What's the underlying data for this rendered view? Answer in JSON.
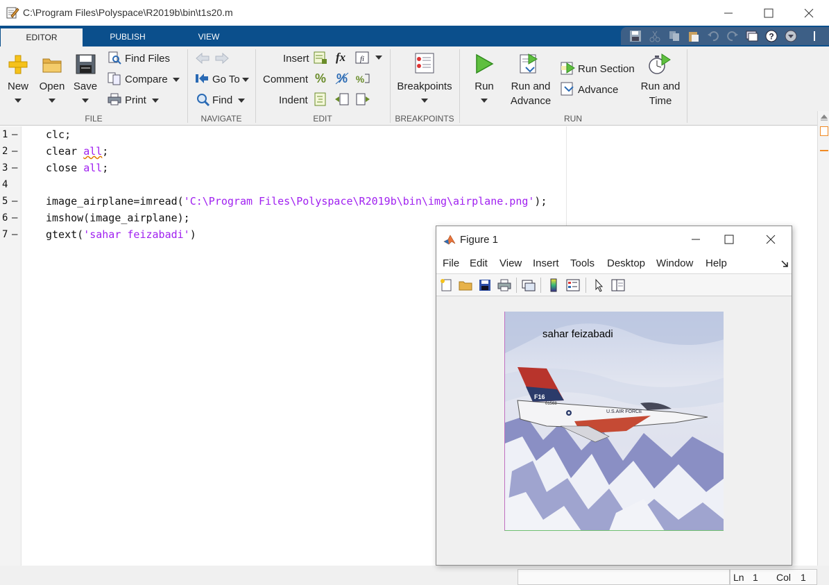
{
  "window": {
    "title": "C:\\Program Files\\Polyspace\\R2019b\\bin\\t1s20.m"
  },
  "tabs": [
    "EDITOR",
    "PUBLISH",
    "VIEW"
  ],
  "ribbon": {
    "file": {
      "group": "FILE",
      "new": "New",
      "open": "Open",
      "save": "Save",
      "find_files": "Find Files",
      "compare": "Compare",
      "print": "Print"
    },
    "navigate": {
      "group": "NAVIGATE",
      "goto": "Go To",
      "find": "Find"
    },
    "edit": {
      "group": "EDIT",
      "insert": "Insert",
      "comment": "Comment",
      "indent": "Indent",
      "fx": "fx"
    },
    "breakpoints": {
      "group": "BREAKPOINTS",
      "label": "Breakpoints"
    },
    "run": {
      "group": "RUN",
      "run": "Run",
      "run_advance_1": "Run and",
      "run_advance_2": "Advance",
      "run_section": "Run Section",
      "advance": "Advance",
      "run_time_1": "Run and",
      "run_time_2": "Time"
    }
  },
  "editor": {
    "lines": [
      {
        "num": "1",
        "dash": "–",
        "parts": [
          [
            "clc;",
            ""
          ]
        ]
      },
      {
        "num": "2",
        "dash": "–",
        "parts": [
          [
            "clear ",
            ""
          ],
          [
            "all",
            "kw-arg squiggle"
          ],
          [
            ";",
            ""
          ]
        ]
      },
      {
        "num": "3",
        "dash": "–",
        "parts": [
          [
            "close ",
            ""
          ],
          [
            "all",
            "kw-arg"
          ],
          [
            ";",
            ""
          ]
        ]
      },
      {
        "num": "4",
        "dash": "",
        "parts": []
      },
      {
        "num": "5",
        "dash": "–",
        "parts": [
          [
            "image_airplane=imread(",
            ""
          ],
          [
            "'C:\\Program Files\\Polyspace\\R2019b\\bin\\img\\airplane.png'",
            "kw-arg"
          ],
          [
            ");",
            ""
          ]
        ]
      },
      {
        "num": "6",
        "dash": "–",
        "parts": [
          [
            "imshow(image_airplane);",
            ""
          ]
        ]
      },
      {
        "num": "7",
        "dash": "–",
        "parts": [
          [
            "gtext(",
            ""
          ],
          [
            "'sahar feizabadi'",
            "kw-arg"
          ],
          [
            ")",
            ""
          ]
        ]
      }
    ]
  },
  "status": {
    "ln_label": "Ln",
    "ln_value": "1",
    "col_label": "Col",
    "col_value": "1"
  },
  "figure": {
    "title": "Figure 1",
    "menu": [
      "File",
      "Edit",
      "View",
      "Insert",
      "Tools",
      "Desktop",
      "Window",
      "Help"
    ],
    "gtext": "sahar feizabadi",
    "image_semantic": "airplane photo (F-16, U.S. AIR FORCE) over snowy mountains",
    "plane_markings": [
      "F16",
      "01568",
      "U.S. AIR FORCE"
    ]
  },
  "colors": {
    "tabstrip": "#0b4f8c",
    "string_purple": "#a020f0",
    "ribbon_bg": "#f0f0f0"
  }
}
